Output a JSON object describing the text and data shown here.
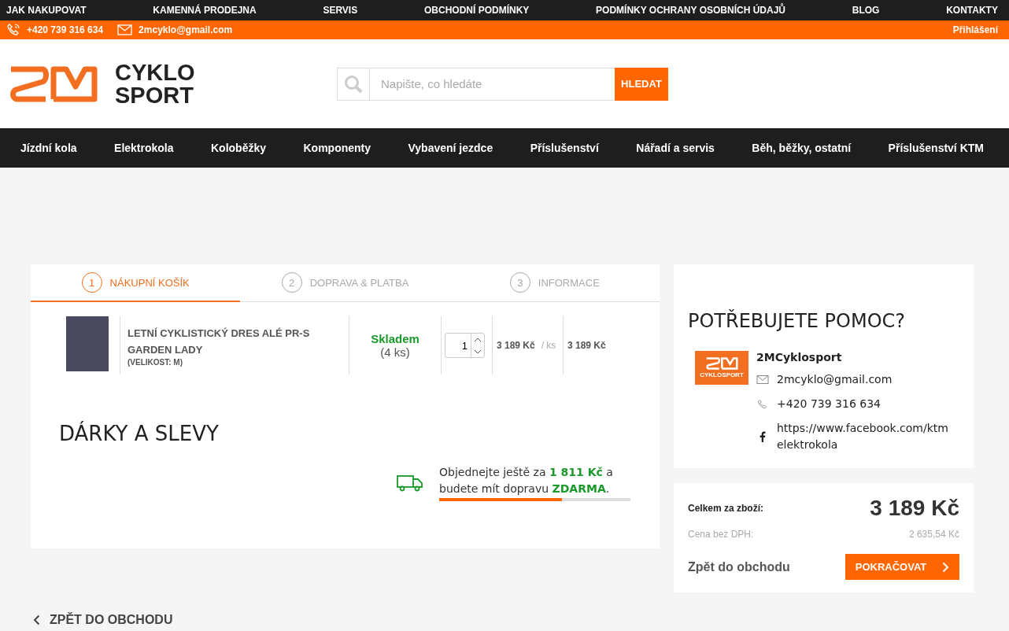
{
  "top_links": [
    "JAK NAKUPOVAT",
    "KAMENNÁ PRODEJNA",
    "SERVIS",
    "OBCHODNÍ PODMÍNKY",
    "PODMÍNKY OCHRANY OSOBNÍCH ÚDAJŮ",
    "BLOG",
    "KONTAKTY"
  ],
  "contact_bar": {
    "phone": "+420 739 316 634",
    "email": "2mcyklo@gmail.com",
    "login": "Přihlášení"
  },
  "logo": {
    "line1": "CYKLO",
    "line2": "SPORT"
  },
  "search": {
    "placeholder": "Napište, co hledáte",
    "button": "HLEDAT"
  },
  "main_nav": [
    "Jízdní kola",
    "Elektrokola",
    "Koloběžky",
    "Komponenty",
    "Vybavení jezdce",
    "Příslušenství",
    "Nářadí a servis",
    "Běh, běžky, ostatní",
    "Příslušenství KTM"
  ],
  "steps": [
    {
      "number": "1",
      "label": "NÁKUPNÍ KOŠÍK",
      "selected": true
    },
    {
      "number": "2",
      "label": "DOPRAVA & PLATBA",
      "selected": false
    },
    {
      "number": "3",
      "label": "INFORMACE",
      "selected": false
    }
  ],
  "cart_items": [
    {
      "name": "LETNÍ CYKLISTICKÝ DRES ALÉ PR-S GARDEN LADY",
      "variant": "(VELIKOST: M)",
      "stock_status": "Skladem",
      "stock_count": "(4 ks)",
      "quantity": "1",
      "unit_price": "3 189 Kč",
      "per_unit": "/ ks",
      "total": "3 189 Kč"
    }
  ],
  "gifts_heading": "DÁRKY A SLEVY",
  "free_shipping": {
    "text": "Objednejte ještě za **1 811 Kč** a budete mít dopravu **ZDARMA**.",
    "level": 0.64
  },
  "help": {
    "title": "POTŘEBUJETE POMOC?",
    "logo_text": "CYKLOSPORT",
    "company": "2MCyklosport",
    "email": "2mcyklo@gmail.com",
    "phone": "+420 739 316 634",
    "facebook": "https://www.facebook.com/ktmelektrokola"
  },
  "summary": {
    "total_label": "Celkem za zboží:",
    "total": "3 189 Kč",
    "net_label": "Cena bez DPH:",
    "net": "2 635,54 Kč",
    "back_link": "Zpět do obchodu",
    "continue_button": "POKRAČOVAT"
  },
  "back_link": "ZPĚT DO OBCHODU"
}
